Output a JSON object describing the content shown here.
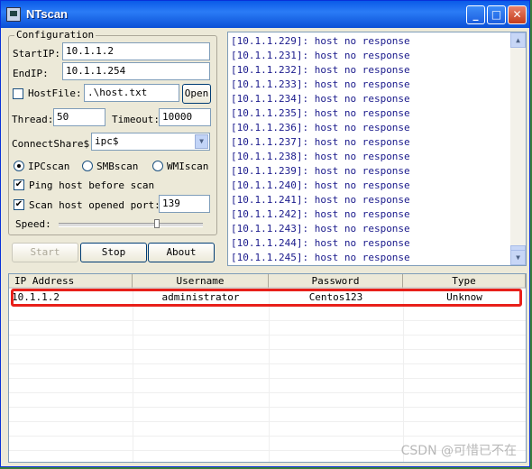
{
  "window": {
    "title": "NTscan"
  },
  "config": {
    "legend": "Configuration",
    "start_ip_label": "StartIP:",
    "start_ip": "10.1.1.2",
    "end_ip_label": "EndIP:",
    "end_ip": "10.1.1.254",
    "hostfile_label": "HostFile:",
    "hostfile": ".\\host.txt",
    "open_label": "Open",
    "thread_label": "Thread:",
    "thread": "50",
    "timeout_label": "Timeout:",
    "timeout": "10000",
    "connectshare_label": "ConnectShare$:",
    "connectshare": "ipc$",
    "ipcscan_label": "IPCscan",
    "smbscan_label": "SMBscan",
    "wmiscan_label": "WMIscan",
    "ping_label": "Ping host before scan",
    "scanport_label": "Scan host opened port:",
    "port": "139",
    "speed_label": "Speed:",
    "speed_level": 0.68
  },
  "actions": {
    "start": "Start",
    "stop": "Stop",
    "about": "About"
  },
  "log": [
    {
      "ip": "[10.1.1.229]:",
      "msg": "host no response"
    },
    {
      "ip": "[10.1.1.231]:",
      "msg": "host no response"
    },
    {
      "ip": "[10.1.1.232]:",
      "msg": "host no response"
    },
    {
      "ip": "[10.1.1.233]:",
      "msg": "host no response"
    },
    {
      "ip": "[10.1.1.234]:",
      "msg": "host no response"
    },
    {
      "ip": "[10.1.1.235]:",
      "msg": "host no response"
    },
    {
      "ip": "[10.1.1.236]:",
      "msg": "host no response"
    },
    {
      "ip": "[10.1.1.237]:",
      "msg": "host no response"
    },
    {
      "ip": "[10.1.1.238]:",
      "msg": "host no response"
    },
    {
      "ip": "[10.1.1.239]:",
      "msg": "host no response"
    },
    {
      "ip": "[10.1.1.240]:",
      "msg": "host no response"
    },
    {
      "ip": "[10.1.1.241]:",
      "msg": "host no response"
    },
    {
      "ip": "[10.1.1.242]:",
      "msg": "host no response"
    },
    {
      "ip": "[10.1.1.243]:",
      "msg": "host no response"
    },
    {
      "ip": "[10.1.1.244]:",
      "msg": "host no response"
    },
    {
      "ip": "[10.1.1.245]:",
      "msg": "host no response"
    }
  ],
  "results": {
    "columns": [
      "IP Address",
      "Username",
      "Password",
      "Type"
    ],
    "rows": [
      [
        "10.1.1.2",
        "administrator",
        "Centos123",
        "Unknow"
      ]
    ]
  },
  "watermark": "CSDN @可惜已不在"
}
